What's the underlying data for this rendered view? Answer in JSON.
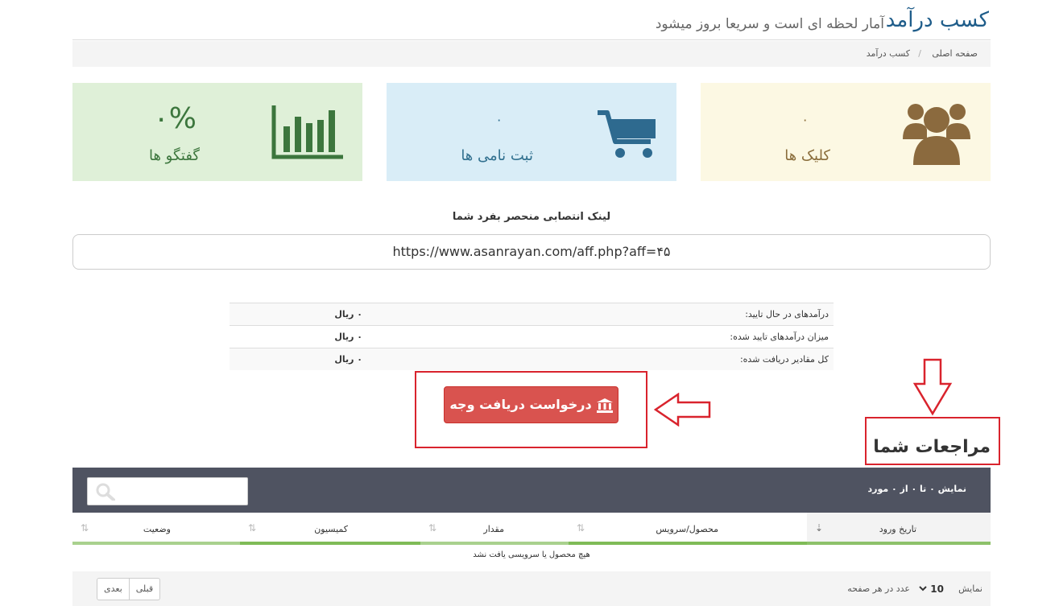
{
  "header": {
    "title": "کسب درآمد",
    "subtitle": "آمار لحظه ای است و سریعا بروز میشود"
  },
  "breadcrumb": {
    "home": "صفحه اصلی",
    "separator": "/",
    "current": "کسب درآمد"
  },
  "stats": {
    "clicks": {
      "value": "۰",
      "label": "کلیک ها",
      "icon": "users-icon"
    },
    "signups": {
      "value": "۰",
      "label": "ثبت نامی ها",
      "icon": "cart-icon"
    },
    "conversations": {
      "value": "۰%",
      "label": "گفتگو ها",
      "icon": "bar-chart-icon"
    }
  },
  "referral": {
    "title": "لینک انتصابی منحصر بفرد شما",
    "url": "https://www.asanrayan.com/aff.php?aff=۴۵"
  },
  "earnings": [
    {
      "label": "درآمدهای در حال تایید:",
      "value": "۰ ریال"
    },
    {
      "label": "میزان درآمدهای تایید شده:",
      "value": "۰ ریال"
    },
    {
      "label": "کل مقادیر دریافت شده:",
      "value": "۰ ریال"
    }
  ],
  "withdraw_button": "درخواست دریافت وجه",
  "section_title": "مراجعات شما",
  "table": {
    "info": "نمایش ۰ تا ۰ از ۰ مورد",
    "columns": [
      "تاریخ ورود",
      "محصول/سرویس",
      "مقدار",
      "کمیسیون",
      "وضعیت"
    ],
    "empty": "هیچ محصول یا سرویسی یافت نشد",
    "show_label": "نمایش",
    "page_size": "10",
    "per_page_label": "عدد در هر صفحه",
    "prev": "قبلی",
    "next": "بعدی"
  },
  "colors": {
    "danger": "#d9534f",
    "annotation": "#d9232d",
    "toolbar": "#4f5361"
  }
}
